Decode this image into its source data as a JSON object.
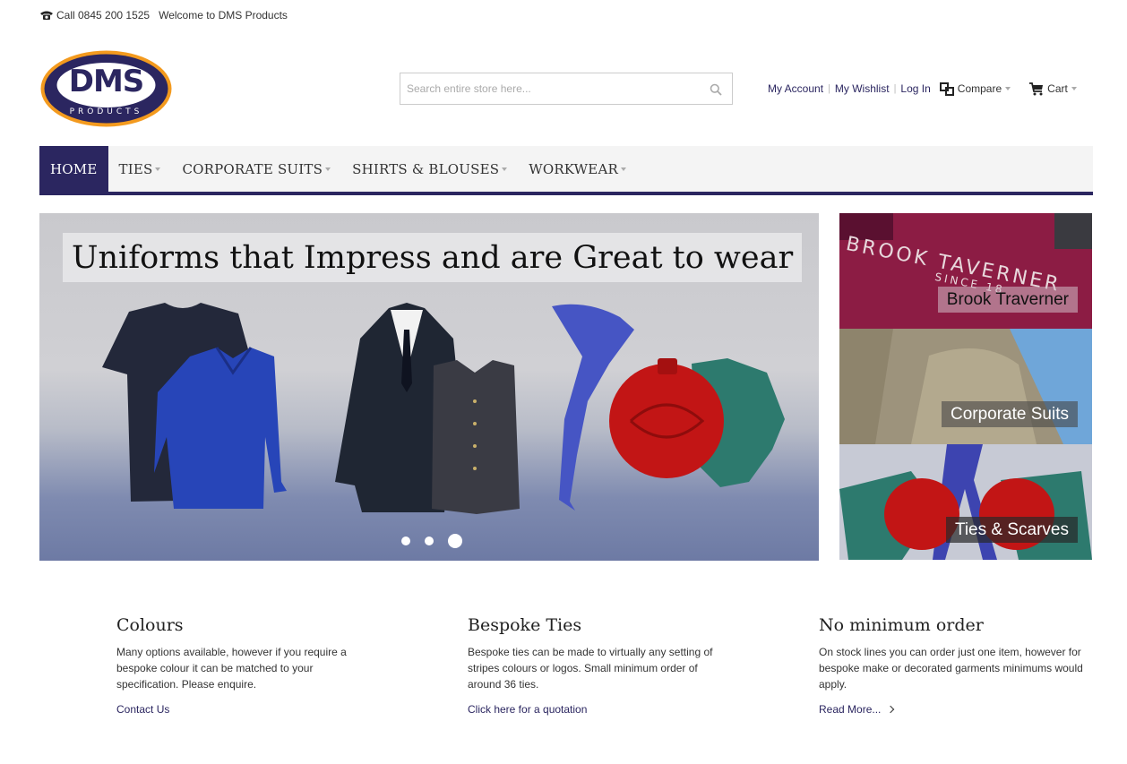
{
  "topbar": {
    "phone_text": "Call 0845 200 1525",
    "welcome_text": "Welcome to DMS Products"
  },
  "logo": {
    "main_text": "DMS",
    "sub_text": "PRODUCTS"
  },
  "search": {
    "placeholder": "Search entire store here..."
  },
  "account": {
    "my_account": "My Account",
    "my_wishlist": "My Wishlist",
    "log_in": "Log In",
    "compare": "Compare",
    "cart": "Cart"
  },
  "nav": {
    "items": [
      {
        "label": "HOME"
      },
      {
        "label": "TIES"
      },
      {
        "label": "CORPORATE SUITS"
      },
      {
        "label": "SHIRTS & BLOUSES"
      },
      {
        "label": "WORKWEAR"
      }
    ]
  },
  "hero": {
    "headline": "Uniforms that Impress and are Great to wear",
    "active_slide": 3,
    "slide_count": 3
  },
  "tiles": [
    {
      "label": "Brook Traverner",
      "photo_text": "BROOK TAVERNER",
      "photo_subtext": "SINCE 18"
    },
    {
      "label": "Corporate Suits"
    },
    {
      "label": "Ties & Scarves"
    }
  ],
  "features": [
    {
      "title": "Colours",
      "body": "Many options available, however if you require a bespoke colour it can be matched to your specification.  Please enquire.",
      "link": "Contact Us"
    },
    {
      "title": "Bespoke Ties",
      "body": "Bespoke ties can be made to virtually any setting of stripes colours or logos. Small minimum order of around 36 ties.",
      "link": "Click here for a quotation"
    },
    {
      "title": "No minimum order",
      "body": "On stock lines you can order just one item, however for bespoke make or decorated garments minimums would apply.",
      "link": "Read More..."
    }
  ],
  "colors": {
    "brand_navy": "#2b2660",
    "logo_orange": "#f39a1e"
  }
}
